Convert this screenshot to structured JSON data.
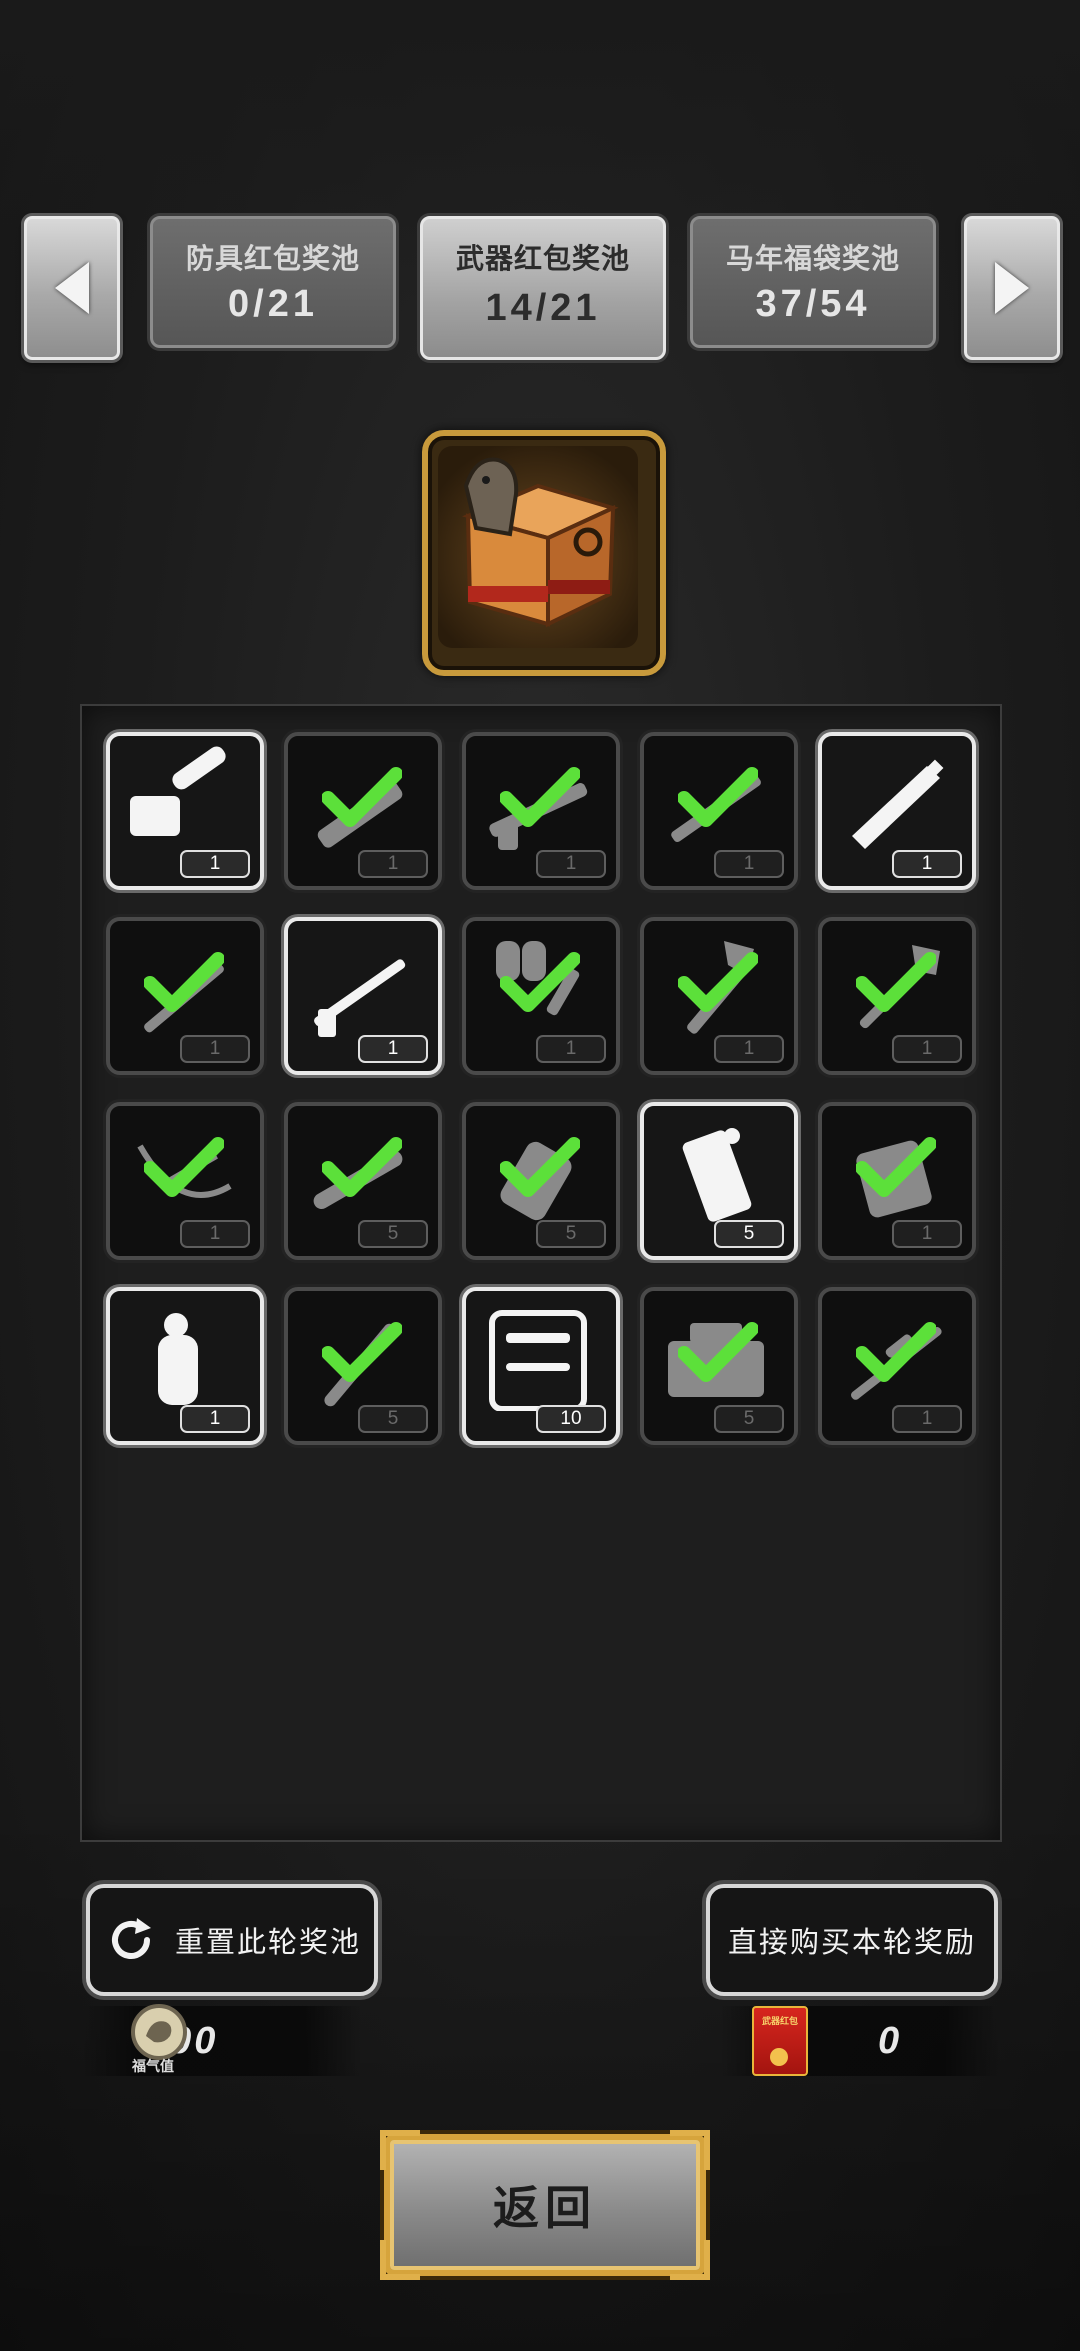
{
  "tabs": [
    {
      "name": "防具红包奖池",
      "count": "0/21",
      "active": false
    },
    {
      "name": "武器红包奖池",
      "count": "14/21",
      "active": true
    },
    {
      "name": "马年福袋奖池",
      "count": "37/54",
      "active": false
    }
  ],
  "grid": [
    {
      "icon": "chainsaw-icon",
      "qty": "1",
      "claimed": false
    },
    {
      "icon": "minigun-icon",
      "qty": "1",
      "claimed": true
    },
    {
      "icon": "shotgun-icon",
      "qty": "1",
      "claimed": true
    },
    {
      "icon": "assault-rifle-icon",
      "qty": "1",
      "claimed": true
    },
    {
      "icon": "sword-icon",
      "qty": "1",
      "claimed": false
    },
    {
      "icon": "knife-icon",
      "qty": "1",
      "claimed": true
    },
    {
      "icon": "rifle-icon",
      "qty": "1",
      "claimed": false
    },
    {
      "icon": "flamethrower-icon",
      "qty": "1",
      "claimed": true
    },
    {
      "icon": "axe-icon",
      "qty": "1",
      "claimed": true
    },
    {
      "icon": "shovel-icon",
      "qty": "1",
      "claimed": true
    },
    {
      "icon": "crossbow-icon",
      "qty": "1",
      "claimed": true
    },
    {
      "icon": "rocket-icon",
      "qty": "5",
      "claimed": true
    },
    {
      "icon": "flashbang-icon",
      "qty": "5",
      "claimed": true
    },
    {
      "icon": "grenade-canister-icon",
      "qty": "5",
      "claimed": false
    },
    {
      "icon": "explosive-pack-icon",
      "qty": "1",
      "claimed": true
    },
    {
      "icon": "grenade-icon",
      "qty": "1",
      "claimed": false
    },
    {
      "icon": "rpg-round-icon",
      "qty": "5",
      "claimed": true
    },
    {
      "icon": "toolkit-icon",
      "qty": "10",
      "claimed": false
    },
    {
      "icon": "toolbox-icon",
      "qty": "5",
      "claimed": true
    },
    {
      "icon": "sniper-rifle-icon",
      "qty": "1",
      "claimed": true
    }
  ],
  "actions": {
    "reset_label": "重置此轮奖池",
    "buy_label": "直接购买本轮奖励",
    "back_label": "返回"
  },
  "currency": {
    "fortune_label": "福气值",
    "fortune_value": "700",
    "envelope_label": "武器红包",
    "envelope_value": "0"
  },
  "colors": {
    "check_green": "#5ce03a",
    "gold_frame": "#d6a43c"
  }
}
